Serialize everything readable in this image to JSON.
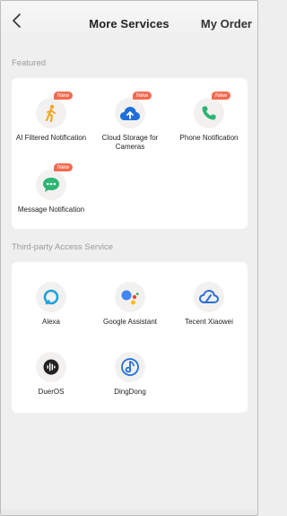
{
  "header": {
    "back_icon": "chevron-left-icon",
    "title": "More Services",
    "my_order": "My Order"
  },
  "featured": {
    "section_label": "Featured",
    "items": [
      {
        "label": "AI Filtered Notification",
        "icon": "walking-person-icon",
        "badge": "New",
        "color": "#f5a623"
      },
      {
        "label": "Cloud Storage for Cameras",
        "icon": "cloud-upload-icon",
        "badge": "New",
        "color": "#1e6fd9"
      },
      {
        "label": "Phone Notification",
        "icon": "phone-icon",
        "badge": "New",
        "color": "#2bb673"
      },
      {
        "label": "Message Notification",
        "icon": "message-bubble-icon",
        "badge": "New",
        "color": "#2bb673"
      }
    ]
  },
  "third_party": {
    "section_label": "Third-party Access Service",
    "items": [
      {
        "label": "Alexa",
        "icon": "alexa-icon",
        "color": "#1fa3d8"
      },
      {
        "label": "Google Assistant",
        "icon": "google-assistant-icon",
        "color": "#4285f4"
      },
      {
        "label": "Tecent Xiaowei",
        "icon": "tencent-xiaowei-icon",
        "color": "#2a6fdb"
      },
      {
        "label": "DuerOS",
        "icon": "dueros-icon",
        "color": "#222222"
      },
      {
        "label": "DingDong",
        "icon": "dingdong-icon",
        "color": "#1e6fd9"
      }
    ]
  }
}
